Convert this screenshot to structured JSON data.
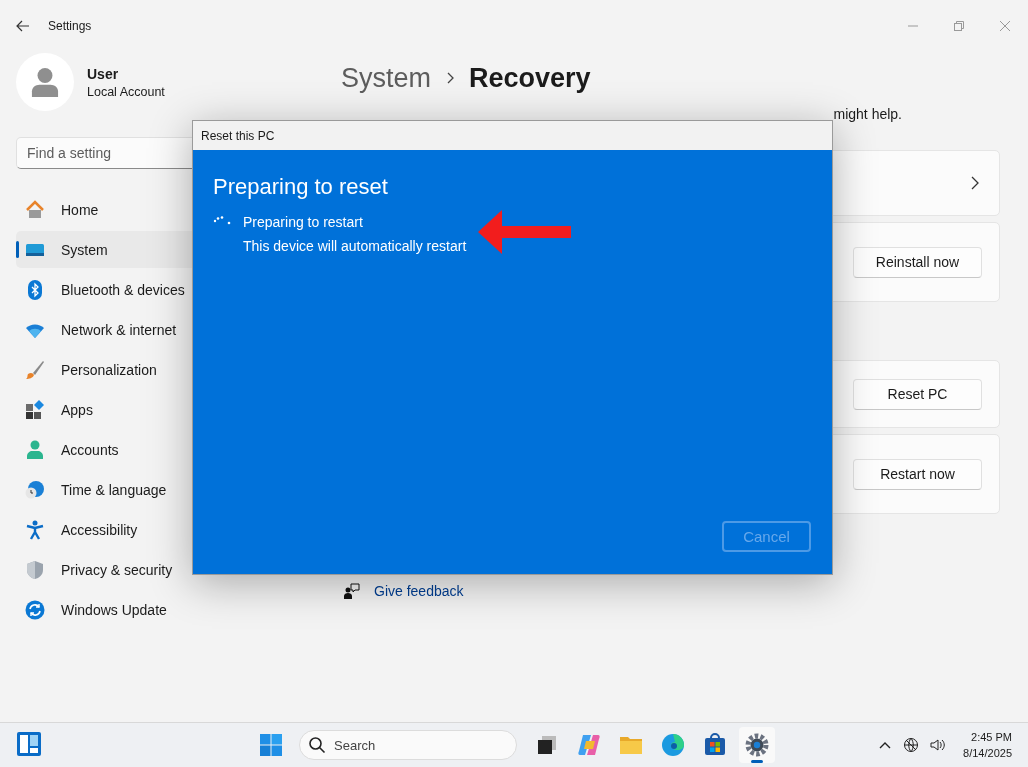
{
  "window": {
    "title": "Settings"
  },
  "user": {
    "name": "User",
    "account": "Local Account"
  },
  "search": {
    "placeholder": "Find a setting"
  },
  "nav": [
    {
      "label": "Home",
      "selected": false
    },
    {
      "label": "System",
      "selected": true
    },
    {
      "label": "Bluetooth & devices",
      "selected": false
    },
    {
      "label": "Network & internet",
      "selected": false
    },
    {
      "label": "Personalization",
      "selected": false
    },
    {
      "label": "Apps",
      "selected": false
    },
    {
      "label": "Accounts",
      "selected": false
    },
    {
      "label": "Time & language",
      "selected": false
    },
    {
      "label": "Accessibility",
      "selected": false
    },
    {
      "label": "Privacy & security",
      "selected": false
    },
    {
      "label": "Windows Update",
      "selected": false
    }
  ],
  "page": {
    "breadcrumb": [
      "System",
      "Recovery"
    ],
    "intro": "might help.",
    "sections": [
      {
        "cards": [
          {
            "kind": "chevron"
          },
          {
            "kind": "button",
            "button": "Reinstall now"
          }
        ]
      },
      {
        "cards": [
          {
            "kind": "button",
            "button": "Reset PC"
          },
          {
            "kind": "button",
            "button": "Restart now"
          }
        ]
      }
    ],
    "links": [
      "Give feedback"
    ]
  },
  "dialog": {
    "title": "Reset this PC",
    "heading": "Preparing to reset",
    "status": "Preparing to restart",
    "detail": "This device will automatically restart",
    "cancel": {
      "label": "Cancel",
      "disabled": true
    }
  },
  "taskbar": {
    "search": "Search",
    "apps": [
      {
        "selected": false
      },
      {
        "selected": false
      },
      {
        "selected": false
      },
      {
        "selected": false
      },
      {
        "selected": false
      },
      {
        "selected": true
      }
    ],
    "time": "2:45 PM",
    "date": "8/14/2025"
  }
}
